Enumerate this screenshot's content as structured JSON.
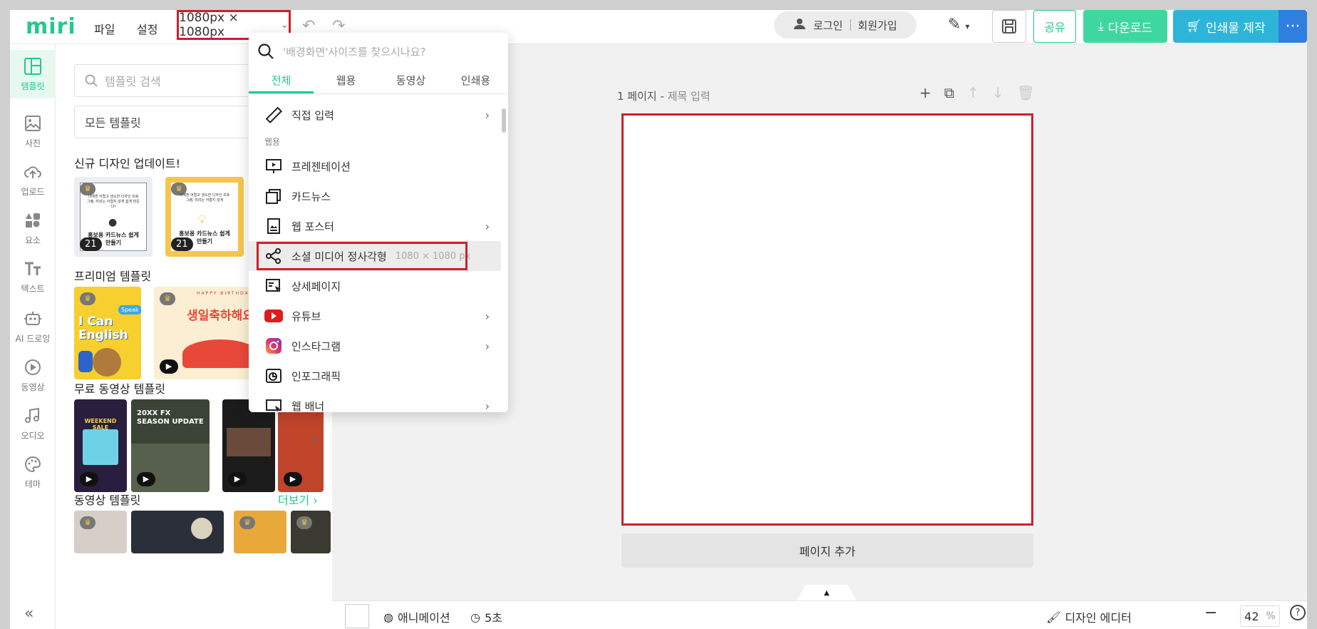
{
  "app": {
    "logo": "miri"
  },
  "topbar": {
    "menu_file": "파일",
    "menu_settings": "설정",
    "size": "1080px × 1080px",
    "login": "로그인",
    "signup": "회원가입",
    "share": "공유",
    "download": "다운로드",
    "print": "인쇄물 제작",
    "more": "···"
  },
  "rail": [
    {
      "label": "템플릿",
      "icon": "template-icon"
    },
    {
      "label": "사진",
      "icon": "photo-icon"
    },
    {
      "label": "업로드",
      "icon": "upload-icon"
    },
    {
      "label": "요소",
      "icon": "elements-icon"
    },
    {
      "label": "텍스트",
      "icon": "text-icon"
    },
    {
      "label": "AI 드로잉",
      "icon": "ai-drawing-icon"
    },
    {
      "label": "동영상",
      "icon": "video-icon"
    },
    {
      "label": "오디오",
      "icon": "audio-icon"
    },
    {
      "label": "테마",
      "icon": "theme-icon"
    }
  ],
  "panel": {
    "search_placeholder": "템플릿 검색",
    "filter": "모든 템플릿",
    "sec_new": "신규 디자인 업데이트!",
    "sec_premium": "프리미엄 템플릿",
    "sec_free_video": "무료 동영상 템플릿",
    "sec_video": "동영상 템플릿",
    "more": "더보기",
    "badge_count": "21",
    "thumb1_text_small": "나에겐 어렵고 생소한 디자인 프로그램, 미리는 어렵지 않게 쉽게 만든다!",
    "thumb1_title": "홍보용 카드뉴스 쉽게 만들기",
    "thumb2_text_small": "나에겐 어렵고 생소한 디자인 프로그램, 미리는 어렵지 않게",
    "thumb2_title": "홍보용 카드뉴스 쉽게 만들기",
    "thumb3_title": "I Can English",
    "thumb3_badge": "Speak",
    "thumb4_title": "생일축하해요",
    "thumb4_banner": "HAPPY BIRTHDAY",
    "thumb5_title": "WEEKEND SALE",
    "thumb6_title": "20XX FX SEASON UPDATE"
  },
  "dropdown": {
    "search_placeholder": "'배경화면'사이즈를 찾으시나요?",
    "tabs": [
      "전체",
      "웹용",
      "동영상",
      "인쇄용"
    ],
    "custom": "직접 입력",
    "group_web": "웹용",
    "items": [
      {
        "label": "프레젠테이션",
        "icon": "presentation-icon",
        "chevron": false
      },
      {
        "label": "카드뉴스",
        "icon": "cardnews-icon",
        "chevron": false
      },
      {
        "label": "웹 포스터",
        "icon": "web-poster-icon",
        "chevron": true
      },
      {
        "label": "소셜 미디어 정사각형",
        "icon": "social-share-icon",
        "chevron": false,
        "size": "1080 × 1080 px"
      },
      {
        "label": "상세페이지",
        "icon": "detail-page-icon",
        "chevron": false
      },
      {
        "label": "유튜브",
        "icon": "youtube-icon",
        "chevron": true
      },
      {
        "label": "인스타그램",
        "icon": "instagram-icon",
        "chevron": true
      },
      {
        "label": "인포그래픽",
        "icon": "infographic-icon",
        "chevron": false
      },
      {
        "label": "웹 배너",
        "icon": "web-banner-icon",
        "chevron": true
      }
    ]
  },
  "canvas": {
    "page_label": "1 페이지",
    "page_title_placeholder": "제목 입력",
    "add_page": "페이지 추가"
  },
  "bottombar": {
    "animation": "애니메이션",
    "duration": "5초",
    "design_editor": "디자인 에디터",
    "zoom_value": "42",
    "zoom_unit": "%"
  },
  "colors": {
    "brand": "#22c98b",
    "highlight": "#d01e2a",
    "download": "#3fd7a0",
    "print": "#2db5d9",
    "more": "#2f7fe0"
  }
}
